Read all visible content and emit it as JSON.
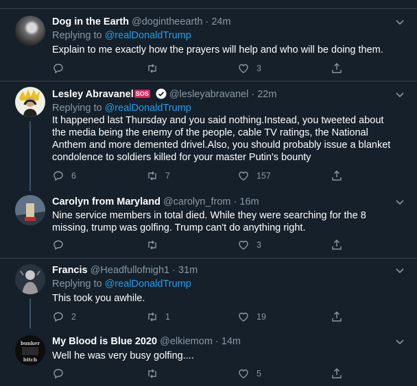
{
  "replying_label": "Replying to",
  "tweets": [
    {
      "name": "Dog in the Earth",
      "handle": "@dogintheearth",
      "time": "24m",
      "reply_to": "@realDonaldTrump",
      "text": "Explain to me exactly how the prayers will help and who will be doing them.",
      "replies": "",
      "retweets": "",
      "likes": "3"
    },
    {
      "name": "Lesley Abravanel",
      "name_badge": "SOS",
      "handle": "@lesleyabravanel",
      "time": "22m",
      "reply_to": "@realDonaldTrump",
      "text": "It happened last Thursday and you said nothing.Instead, you tweeted about the media being the enemy of the people, cable TV ratings, the National Anthem and more demented drivel.Also, you should probably issue a blanket condolence to soldiers killed for your master Putin's bounty",
      "replies": "6",
      "retweets": "7",
      "likes": "157"
    },
    {
      "name": "Carolyn from Maryland",
      "handle": "@carolyn_from",
      "time": "16m",
      "text": "Nine service members in total died. While they were searching  for the 8 missing, trump was golfing. Trump can't do anything right.",
      "replies": "",
      "retweets": "",
      "likes": "3"
    },
    {
      "name": "Francis",
      "handle": "@Headfullofnigh1",
      "time": "31m",
      "reply_to": "@realDonaldTrump",
      "text": "This took you awhile.",
      "replies": "2",
      "retweets": "1",
      "likes": "19"
    },
    {
      "name": "My Blood is Blue 2020",
      "handle": "@elkiemom",
      "time": "14m",
      "text": "Well he was very busy golfing....",
      "replies": "",
      "retweets": "",
      "likes": "5",
      "avatar_text_top": "bunker",
      "avatar_text_bottom": "bitch"
    }
  ],
  "colors": {
    "background": "#15202b",
    "border": "#38444d",
    "secondary_text": "#8899a6",
    "link": "#1da1f2",
    "badge": "#e0245e"
  },
  "icons": [
    "reply-icon",
    "retweet-icon",
    "like-icon",
    "share-icon",
    "chevron-down-icon",
    "verified-icon"
  ]
}
